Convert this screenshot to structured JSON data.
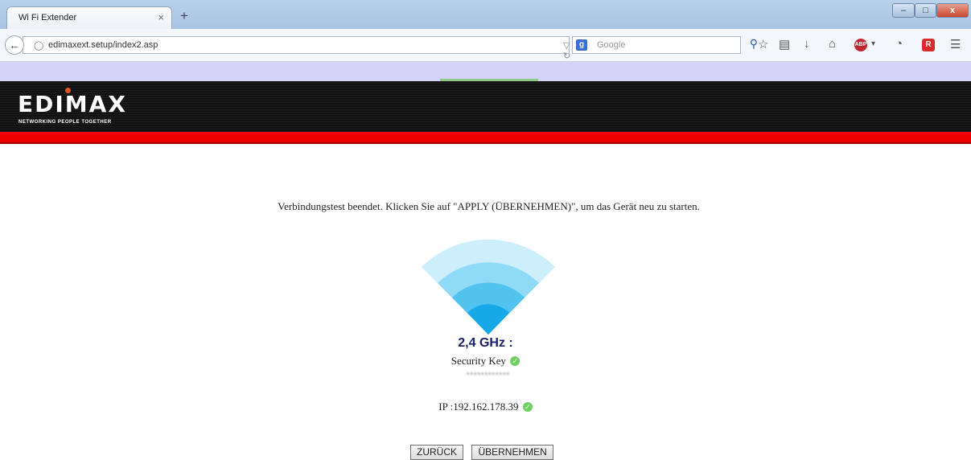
{
  "browser": {
    "tab_title": "Wi Fi Extender",
    "tab_close": "×",
    "new_tab": "+",
    "window_controls": {
      "minimize": "–",
      "maximize": "□",
      "close": "x"
    },
    "url": "edimaxext.setup/index2.asp",
    "search_engine": "Google",
    "search_placeholder": "Google",
    "toolbar_icons": [
      "search-icon",
      "bookmark-star-icon",
      "reading-list-icon",
      "download-icon",
      "home-icon",
      "adblock-icon",
      "sync-icon",
      "extension-icon",
      "menu-icon"
    ]
  },
  "brand": {
    "logo": "EDIMAX",
    "tagline": "NETWORKING PEOPLE TOGETHER"
  },
  "main": {
    "message": "Verbindungstest beendet. Klicken Sie auf \"APPLY (ÜBERNEHMEN)\", um das Gerät neu zu starten.",
    "frequency": "2,4 GHz :",
    "security_key_label": "Security Key",
    "security_key_value": "••••••••••••",
    "ip_text": "IP :192.162.178.39"
  },
  "buttons": {
    "back": "ZURÜCK",
    "apply": "ÜBERNEHMEN"
  },
  "colors": {
    "header_red": "#ee0000",
    "frequency_text": "#1b1f6b",
    "wifi_light": "#cdeffb",
    "wifi_dark": "#17a8e8"
  }
}
